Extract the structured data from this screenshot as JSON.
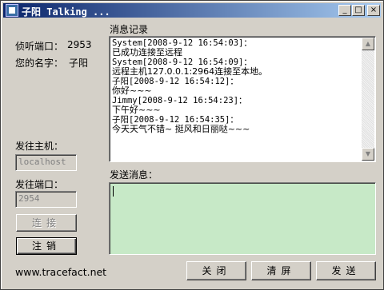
{
  "window": {
    "title": "子阳 Talking ...",
    "controls": [
      "_",
      "□",
      "×"
    ]
  },
  "info": {
    "port_label": "侦听端口：",
    "port_value": "2953",
    "name_label": "您的名字：",
    "name_value": "子阳"
  },
  "send_host": {
    "label": "发往主机：",
    "value": "localhost"
  },
  "send_port": {
    "label": "发往端口：",
    "value": "2954"
  },
  "buttons": {
    "connect": "连接",
    "logout": "注销",
    "close": "关闭",
    "clear": "清屏",
    "send": "发送"
  },
  "footer_url": "www.tracefact.net",
  "log": {
    "label": "消息记录",
    "lines": [
      {
        "text": "System[2008-9-12 16:54:03]：",
        "type": "meta"
      },
      {
        "text": "已成功连接至远程",
        "type": "msg"
      },
      {
        "text": "System[2008-9-12 16:54:09]：",
        "type": "meta"
      },
      {
        "text": "远程主机127.0.0.1:2964连接至本地。",
        "type": "msg"
      },
      {
        "text": "子阳[2008-9-12 16:54:12]：",
        "type": "meta"
      },
      {
        "text": "你好~~~",
        "type": "msg"
      },
      {
        "text": "Jimmy[2008-9-12 16:54:23]：",
        "type": "meta"
      },
      {
        "text": "下午好~~~",
        "type": "msg"
      },
      {
        "text": "子阳[2008-9-12 16:54:35]：",
        "type": "meta"
      },
      {
        "text": "今天天气不错~ 挺风和日丽哒~~~",
        "type": "msg"
      }
    ]
  },
  "compose": {
    "label": "发送消息：",
    "value": ""
  }
}
